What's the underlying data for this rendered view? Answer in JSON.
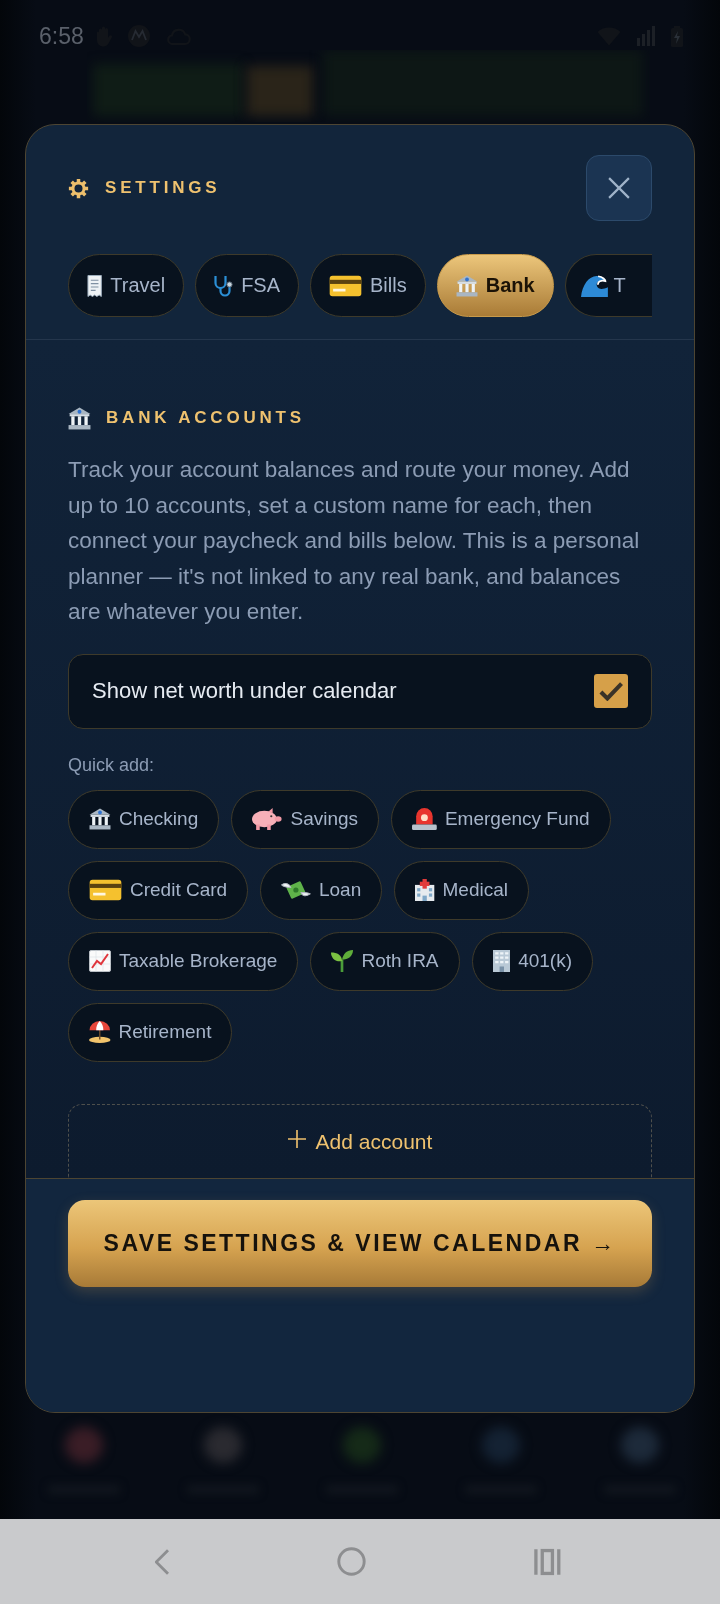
{
  "status_bar": {
    "time": "6:58"
  },
  "settings": {
    "title": "SETTINGS",
    "tabs": [
      {
        "label": "Travel",
        "selected": false
      },
      {
        "label": "FSA",
        "selected": false
      },
      {
        "label": "Bills",
        "selected": false
      },
      {
        "label": "Bank",
        "selected": true
      },
      {
        "label": "T",
        "selected": false
      }
    ],
    "section": {
      "title": "BANK ACCOUNTS",
      "description": "Track your account balances and route your money. Add up to 10 accounts, set a custom name for each, then connect your paycheck and bills below. This is a personal planner — it's not linked to any real bank, and balances are whatever you enter."
    },
    "net_worth_toggle": {
      "label": "Show net worth under calendar",
      "checked": true
    },
    "quick_add": {
      "label": "Quick add:",
      "options": [
        "Checking",
        "Savings",
        "Emergency Fund",
        "Credit Card",
        "Loan",
        "Medical",
        "Taxable Brokerage",
        "Roth IRA",
        "401(k)",
        "Retirement"
      ]
    },
    "add_account_button": "Add account",
    "save_button": "SAVE SETTINGS & VIEW CALENDAR →"
  }
}
